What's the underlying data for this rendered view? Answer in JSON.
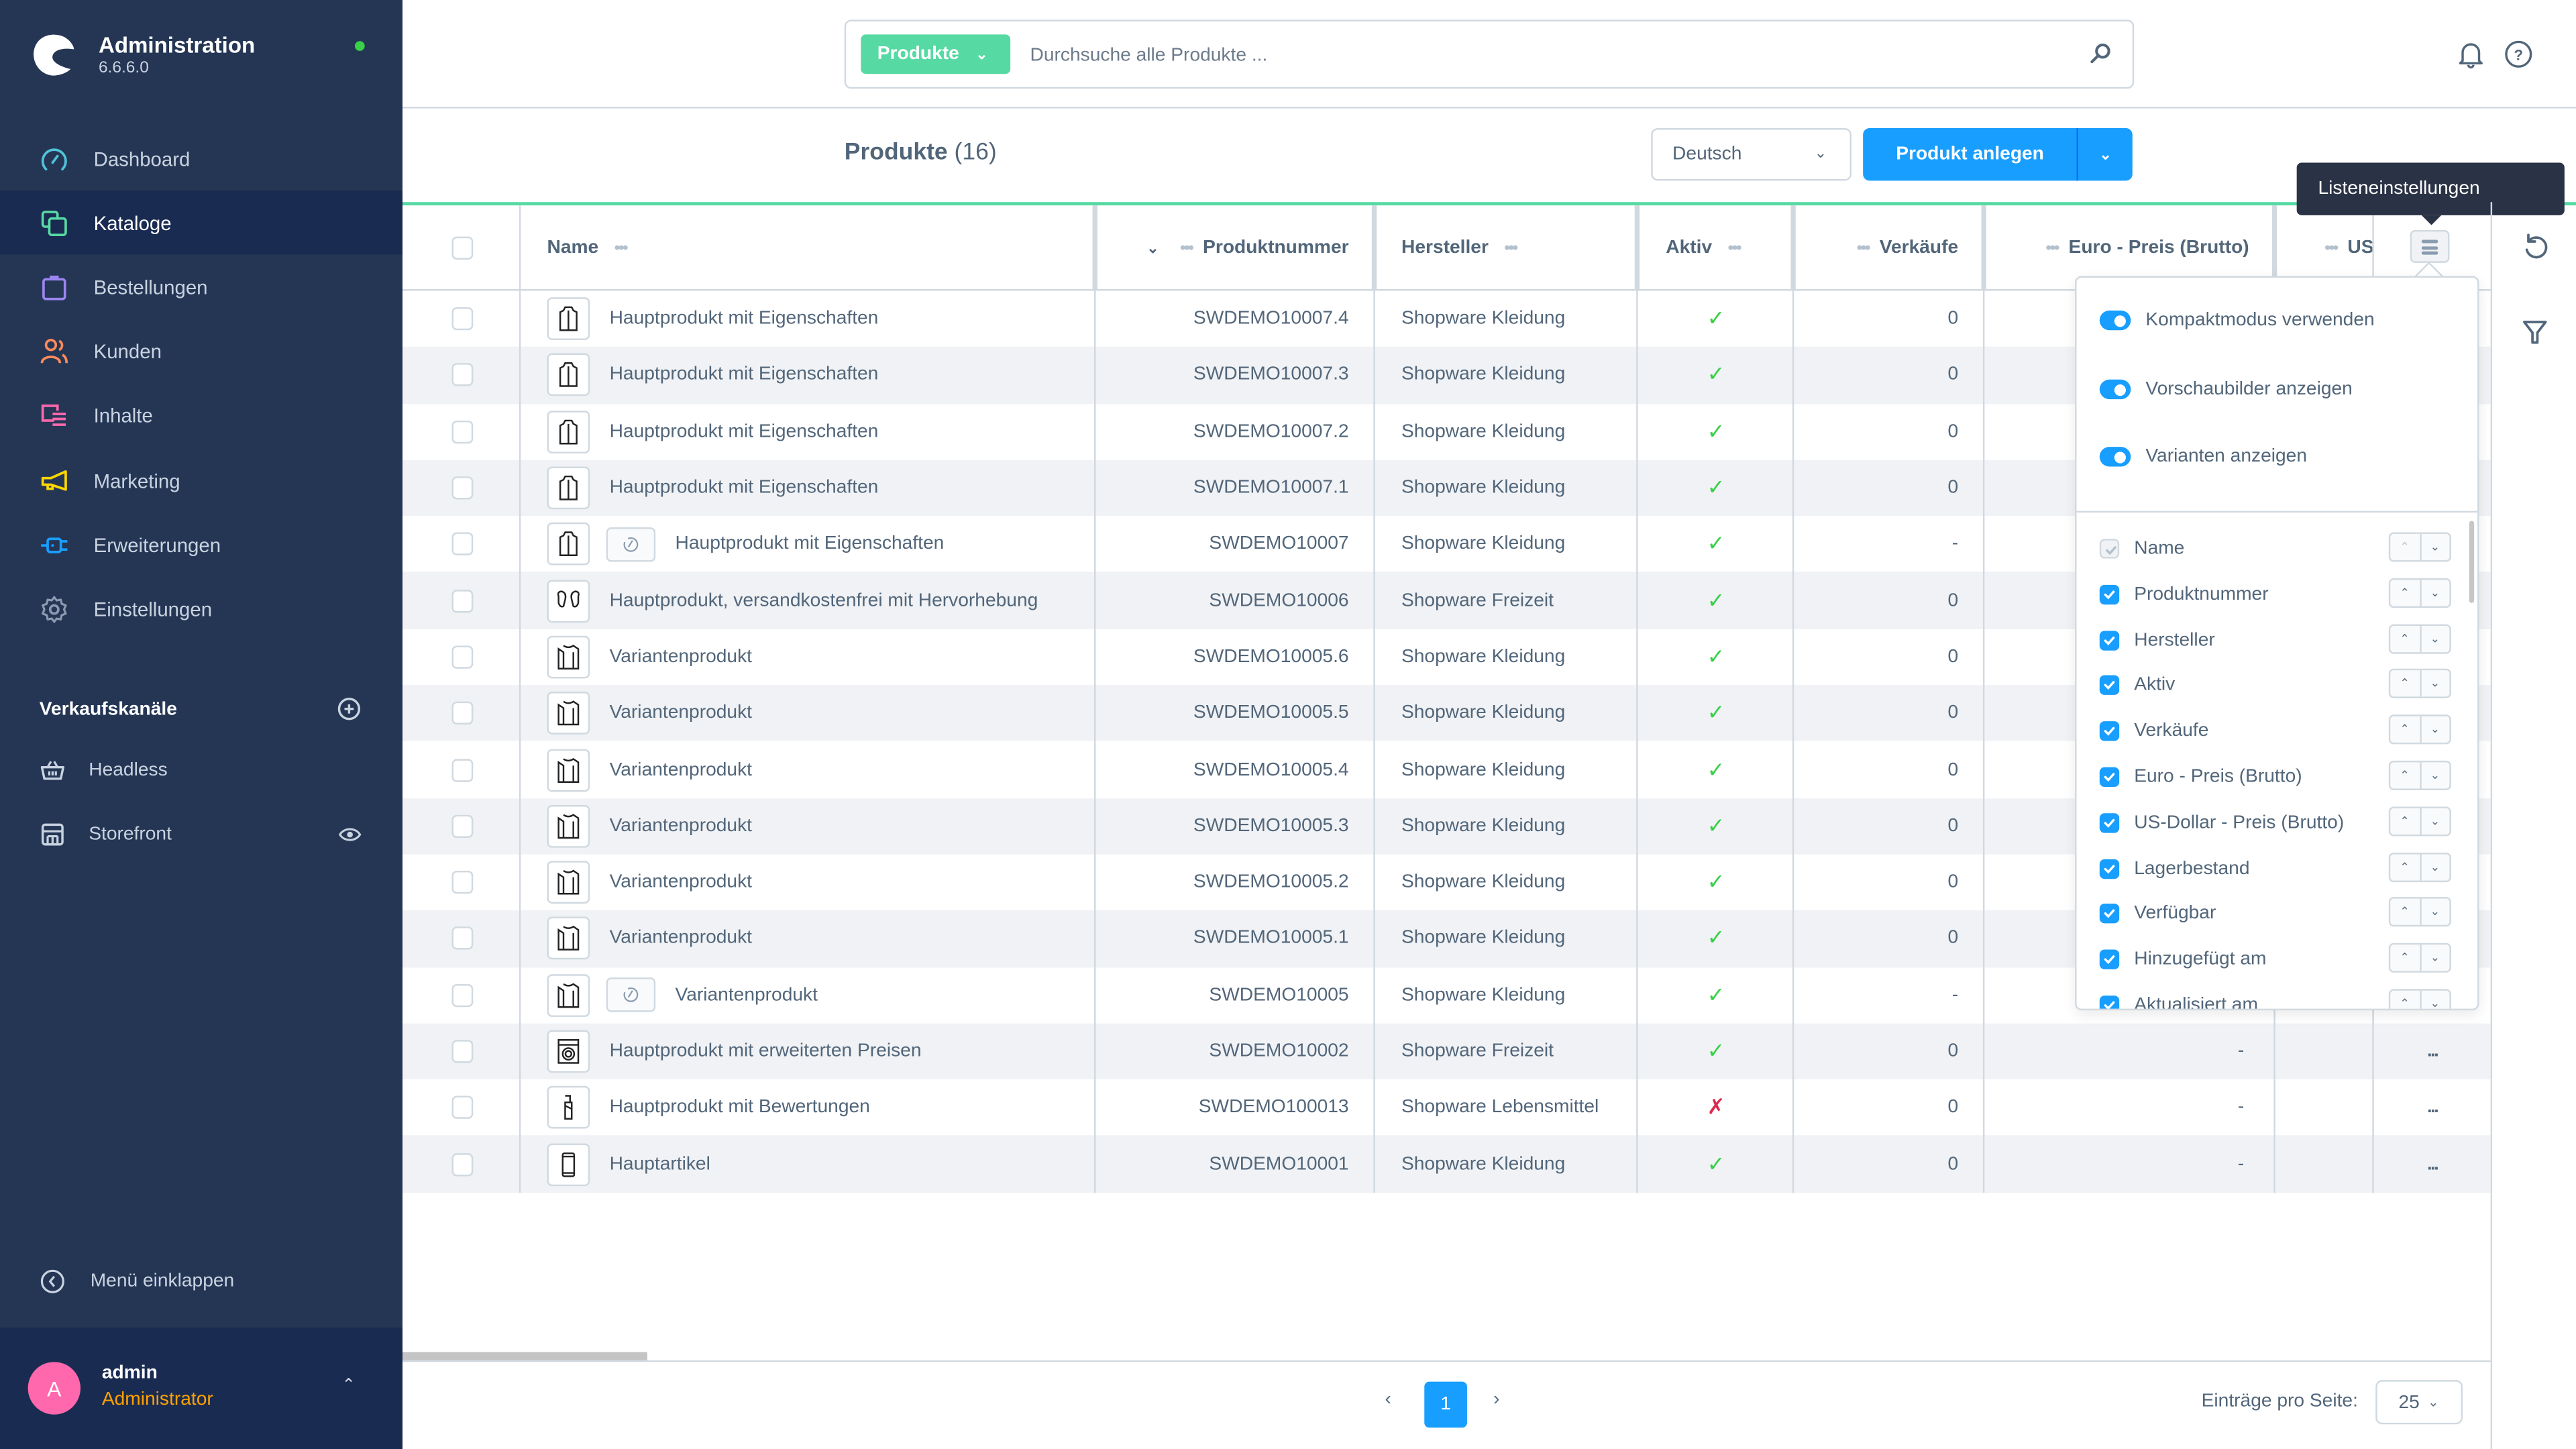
{
  "app": {
    "title": "Administration",
    "version": "6.6.6.0",
    "status_color": "#37d046"
  },
  "sidebar": {
    "items": [
      {
        "label": "Dashboard",
        "icon": "gauge-icon",
        "color": "#4fc3d9"
      },
      {
        "label": "Kataloge",
        "icon": "catalog-icon",
        "color": "#57d9a3",
        "active": true
      },
      {
        "label": "Bestellungen",
        "icon": "shopping-bag-icon",
        "color": "#9c85f0"
      },
      {
        "label": "Kunden",
        "icon": "users-icon",
        "color": "#ff8a5b"
      },
      {
        "label": "Inhalte",
        "icon": "content-icon",
        "color": "#ff68ac"
      },
      {
        "label": "Marketing",
        "icon": "megaphone-icon",
        "color": "#ffd700"
      },
      {
        "label": "Erweiterungen",
        "icon": "plug-icon",
        "color": "#189eff"
      },
      {
        "label": "Einstellungen",
        "icon": "gear-icon",
        "color": "#8a9bb0"
      }
    ],
    "sales_channels_title": "Verkaufskanäle",
    "sales_channels": [
      {
        "label": "Headless",
        "icon": "basket-icon"
      },
      {
        "label": "Storefront",
        "icon": "storefront-icon"
      }
    ],
    "collapse_label": "Menü einklappen",
    "user": {
      "initial": "A",
      "name": "admin",
      "role": "Administrator"
    }
  },
  "search": {
    "type_label": "Produkte",
    "placeholder": "Durchsuche alle Produkte ...",
    "value": ""
  },
  "smartbar": {
    "title": "Produkte",
    "count": "(16)",
    "language": "Deutsch",
    "create_label": "Produkt anlegen"
  },
  "grid": {
    "columns": {
      "name": "Name",
      "product_number": "Produktnummer",
      "manufacturer": "Hersteller",
      "active": "Aktiv",
      "sales": "Verkäufe",
      "price_eur": "Euro - Preis (Brutto)",
      "price_usd": "US"
    },
    "rows": [
      {
        "name": "Hauptprodukt mit Eigenschaften",
        "thumb": "jacket",
        "variant_badge": false,
        "number": "SWDEMO10007.4",
        "manufacturer": "Shopware Kleidung",
        "active": true,
        "sales": "0"
      },
      {
        "name": "Hauptprodukt mit Eigenschaften",
        "thumb": "jacket",
        "variant_badge": false,
        "number": "SWDEMO10007.3",
        "manufacturer": "Shopware Kleidung",
        "active": true,
        "sales": "0"
      },
      {
        "name": "Hauptprodukt mit Eigenschaften",
        "thumb": "jacket",
        "variant_badge": false,
        "number": "SWDEMO10007.2",
        "manufacturer": "Shopware Kleidung",
        "active": true,
        "sales": "0"
      },
      {
        "name": "Hauptprodukt mit Eigenschaften",
        "thumb": "jacket",
        "variant_badge": false,
        "number": "SWDEMO10007.1",
        "manufacturer": "Shopware Kleidung",
        "active": true,
        "sales": "0"
      },
      {
        "name": "Hauptprodukt mit Eigenschaften",
        "thumb": "jacket",
        "variant_badge": true,
        "number": "SWDEMO10007",
        "manufacturer": "Shopware Kleidung",
        "active": true,
        "sales": "-"
      },
      {
        "name": "Hauptprodukt, versandkostenfrei mit Hervorhebung",
        "thumb": "gloves",
        "variant_badge": false,
        "number": "SWDEMO10006",
        "manufacturer": "Shopware Freizeit",
        "active": true,
        "sales": "0"
      },
      {
        "name": "Variantenprodukt",
        "thumb": "sweater",
        "variant_badge": false,
        "number": "SWDEMO10005.6",
        "manufacturer": "Shopware Kleidung",
        "active": true,
        "sales": "0"
      },
      {
        "name": "Variantenprodukt",
        "thumb": "sweater",
        "variant_badge": false,
        "number": "SWDEMO10005.5",
        "manufacturer": "Shopware Kleidung",
        "active": true,
        "sales": "0"
      },
      {
        "name": "Variantenprodukt",
        "thumb": "sweater",
        "variant_badge": false,
        "number": "SWDEMO10005.4",
        "manufacturer": "Shopware Kleidung",
        "active": true,
        "sales": "0"
      },
      {
        "name": "Variantenprodukt",
        "thumb": "sweater",
        "variant_badge": false,
        "number": "SWDEMO10005.3",
        "manufacturer": "Shopware Kleidung",
        "active": true,
        "sales": "0"
      },
      {
        "name": "Variantenprodukt",
        "thumb": "sweater",
        "variant_badge": false,
        "number": "SWDEMO10005.2",
        "manufacturer": "Shopware Kleidung",
        "active": true,
        "sales": "0"
      },
      {
        "name": "Variantenprodukt",
        "thumb": "sweater",
        "variant_badge": false,
        "number": "SWDEMO10005.1",
        "manufacturer": "Shopware Kleidung",
        "active": true,
        "sales": "0"
      },
      {
        "name": "Variantenprodukt",
        "thumb": "sweater",
        "variant_badge": true,
        "number": "SWDEMO10005",
        "manufacturer": "Shopware Kleidung",
        "active": true,
        "sales": "-"
      },
      {
        "name": "Hauptprodukt mit erweiterten Preisen",
        "thumb": "washer",
        "variant_badge": false,
        "number": "SWDEMO10002",
        "manufacturer": "Shopware Freizeit",
        "active": true,
        "sales": "0",
        "price_eur": "-"
      },
      {
        "name": "Hauptprodukt mit Bewertungen",
        "thumb": "chocolate",
        "variant_badge": false,
        "number": "SWDEMO100013",
        "manufacturer": "Shopware Lebensmittel",
        "active": false,
        "sales": "0",
        "price_eur": "-"
      },
      {
        "name": "Hauptartikel",
        "thumb": "phone",
        "variant_badge": false,
        "number": "SWDEMO10001",
        "manufacturer": "Shopware Kleidung",
        "active": true,
        "sales": "0",
        "price_eur": "-"
      }
    ],
    "row_actions_label": "..."
  },
  "tooltip": {
    "text": "Listeneinstellungen"
  },
  "list_settings": {
    "toggles": [
      {
        "label": "Kompaktmodus verwenden",
        "on": true
      },
      {
        "label": "Vorschaubilder anzeigen",
        "on": true
      },
      {
        "label": "Varianten anzeigen",
        "on": true
      }
    ],
    "columns": [
      {
        "label": "Name",
        "checked": true,
        "disabled": true
      },
      {
        "label": "Produktnummer",
        "checked": true
      },
      {
        "label": "Hersteller",
        "checked": true
      },
      {
        "label": "Aktiv",
        "checked": true
      },
      {
        "label": "Verkäufe",
        "checked": true
      },
      {
        "label": "Euro - Preis (Brutto)",
        "checked": true
      },
      {
        "label": "US-Dollar - Preis (Brutto)",
        "checked": true
      },
      {
        "label": "Lagerbestand",
        "checked": true
      },
      {
        "label": "Verfügbar",
        "checked": true
      },
      {
        "label": "Hinzugefügt am",
        "checked": true
      },
      {
        "label": "Aktualisiert am",
        "checked": true
      }
    ]
  },
  "pagination": {
    "current_page": "1",
    "per_page_label": "Einträge pro Seite:",
    "per_page": "25"
  },
  "colors": {
    "sidebar_bg": "#253655",
    "sidebar_active": "#1a2b52",
    "primary": "#189eff",
    "accent_green": "#57d9a3",
    "success": "#37d046",
    "danger": "#de294c",
    "role": "#ffa200",
    "avatar": "#ff68ac"
  }
}
